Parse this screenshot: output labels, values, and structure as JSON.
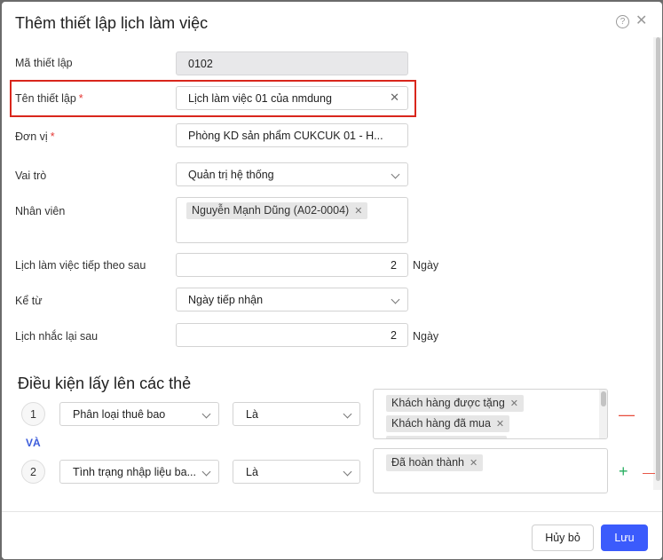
{
  "dialog": {
    "title": "Thêm thiết lập lịch làm việc",
    "help_icon": "question-circle-icon",
    "close_icon": "close-icon"
  },
  "form": {
    "code": {
      "label": "Mã thiết lập",
      "value": "0102"
    },
    "name": {
      "label": "Tên thiết lập",
      "required": "*",
      "value": "Lịch làm việc 01 của nmdung"
    },
    "unit": {
      "label": "Đơn vị",
      "required": "*",
      "value": "Phòng KD sản phẩm CUKCUK 01 - H..."
    },
    "role": {
      "label": "Vai trò",
      "value": "Quản trị hệ thống"
    },
    "employee": {
      "label": "Nhân viên",
      "tags": [
        "Nguyễn Mạnh Dũng (A02-0004)"
      ]
    },
    "next_schedule": {
      "label": "Lịch làm việc tiếp theo sau",
      "value": "2",
      "unit": "Ngày"
    },
    "from": {
      "label": "Kể từ",
      "value": "Ngày tiếp nhận"
    },
    "remind": {
      "label": "Lịch nhắc lại sau",
      "value": "2",
      "unit": "Ngày"
    }
  },
  "conditions": {
    "title": "Điều kiện lấy lên các thẻ",
    "connector": "VÀ",
    "rows": [
      {
        "index": "1",
        "field": "Phân loại thuê bao",
        "operator": "Là",
        "values": [
          "Khách hàng được tặng",
          "Khách hàng đã mua"
        ]
      },
      {
        "index": "2",
        "field": "Tình trạng nhập liệu ba...",
        "operator": "Là",
        "values": [
          "Đã hoàn thành"
        ]
      }
    ]
  },
  "footer": {
    "cancel_label": "Hủy bỏ",
    "save_label": "Lưu"
  },
  "colors": {
    "primary": "#3b5bfc",
    "required": "#e53935",
    "highlight": "#d9261c",
    "add": "#27ae60",
    "remove": "#e74c3c"
  }
}
